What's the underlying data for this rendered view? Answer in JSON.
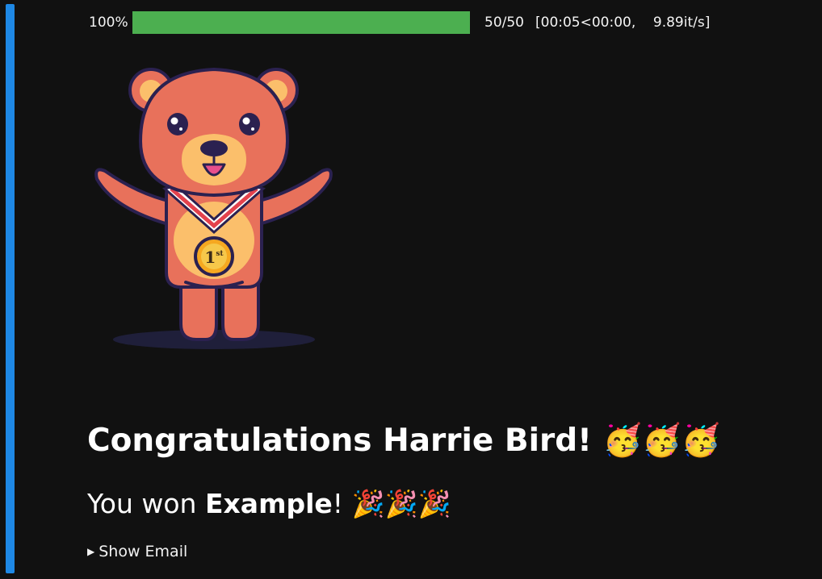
{
  "progress": {
    "percent_label": "100%",
    "fraction": 1.0,
    "count_label": "50/50",
    "timing_label": "[00:05<00:00,    9.89it/s]",
    "bar_color": "#4caf50"
  },
  "image": {
    "subject": "bear-with-first-place-medal",
    "medal_text": "1st"
  },
  "congrats": {
    "heading_text": "Congratulations Harrie Bird! 🥳🥳🥳",
    "win_prefix": "You won ",
    "prize_name": "Example",
    "win_suffix": "! 🎉🎉🎉"
  },
  "email_toggle": {
    "arrow": "▶",
    "label": "Show Email"
  },
  "colors": {
    "background": "#111111",
    "cell_indicator": "#1e88e5"
  }
}
